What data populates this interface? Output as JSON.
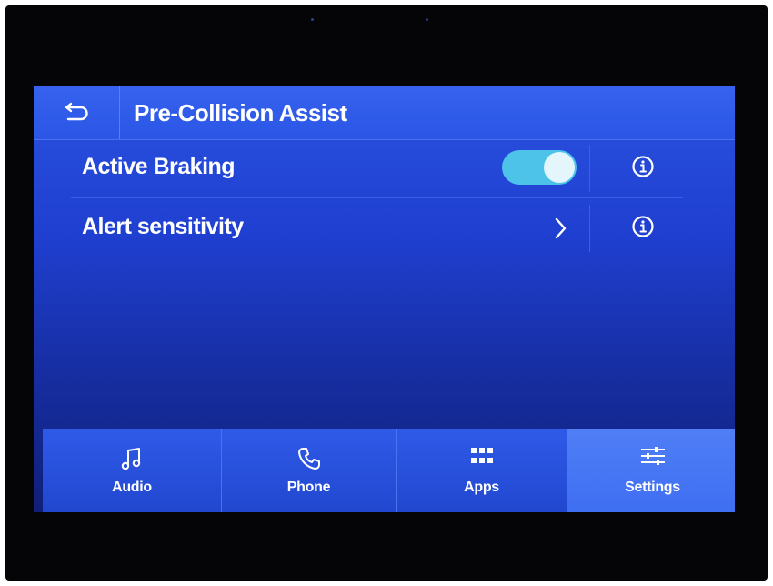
{
  "header": {
    "title": "Pre-Collision Assist",
    "back_icon": "back-arrow-icon"
  },
  "settings": [
    {
      "label": "Active Braking",
      "control": "toggle",
      "toggle_on": true,
      "info_icon": "info-icon"
    },
    {
      "label": "Alert sensitivity",
      "control": "chevron",
      "info_icon": "info-icon"
    }
  ],
  "nav": {
    "items": [
      {
        "label": "Audio",
        "icon": "music-note-icon",
        "active": false
      },
      {
        "label": "Phone",
        "icon": "phone-icon",
        "active": false
      },
      {
        "label": "Apps",
        "icon": "apps-grid-icon",
        "active": false
      },
      {
        "label": "Settings",
        "icon": "settings-sliders-icon",
        "active": true
      }
    ]
  },
  "colors": {
    "screen_blue": "#1f3fd0",
    "toggle_on": "#4ec3ea",
    "nav_active": "#4f7ef6",
    "text": "#ffffff"
  }
}
